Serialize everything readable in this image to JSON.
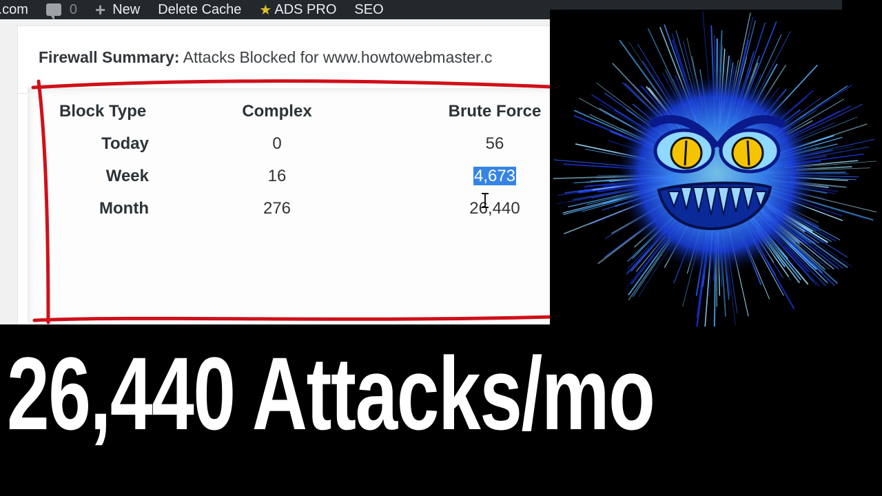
{
  "adminbar": {
    "site_label": "r.com",
    "comments_count": "0",
    "new_label": "New",
    "delete_cache_label": "Delete Cache",
    "ads_pro_label": "ADS PRO",
    "seo_label": "SEO"
  },
  "panel": {
    "title_bold": "Firewall Summary:",
    "title_rest": "Attacks Blocked for www.howtowebmaster.c"
  },
  "stats_table": {
    "headers": [
      "Block Type",
      "Complex",
      "Brute Force"
    ],
    "rows": [
      {
        "label": "Today",
        "complex": "0",
        "brute_force": "56"
      },
      {
        "label": "Week",
        "complex": "16",
        "brute_force": "4,673"
      },
      {
        "label": "Month",
        "complex": "276",
        "brute_force": "26,440"
      }
    ]
  },
  "colors": {
    "adminbar_bg": "#23282d",
    "annotation_red": "#d0101a",
    "selection_blue": "#3584e4",
    "monster_blue": "#2d6cff",
    "monster_eye": "#f5c400"
  },
  "caption": {
    "text": "26,440 Attacks/mo"
  },
  "illustration": {
    "subject": "blue-furry-monster"
  }
}
